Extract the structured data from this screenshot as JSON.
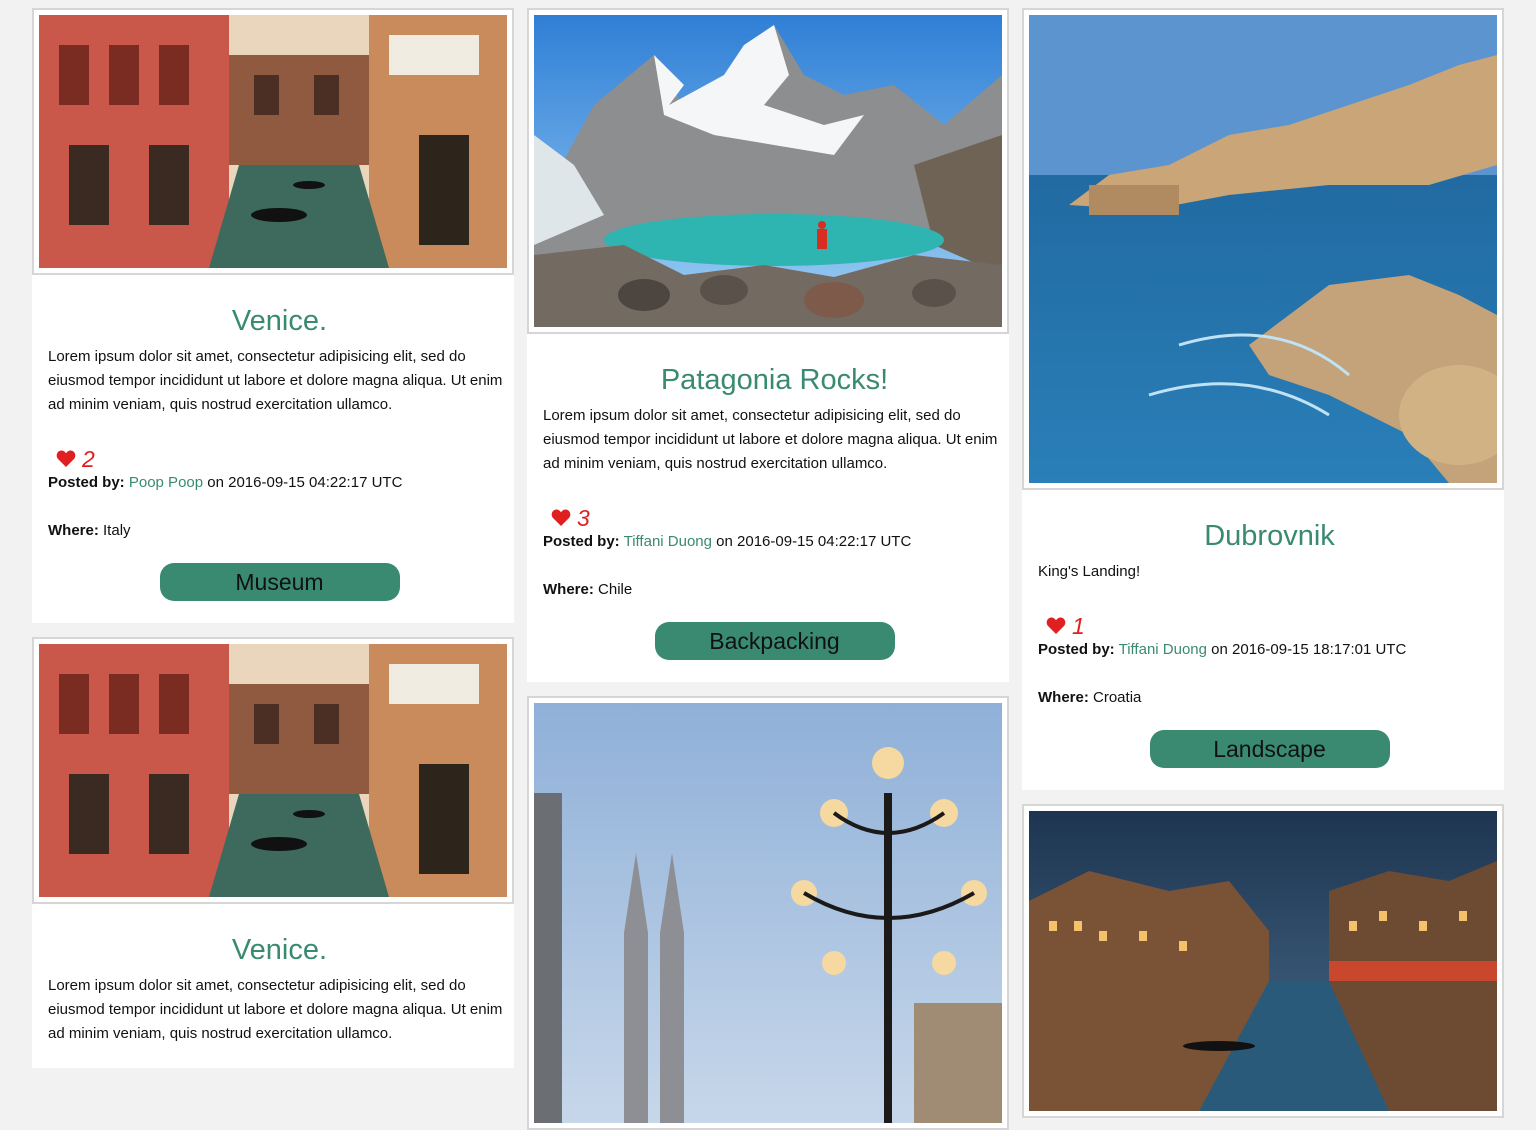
{
  "labels": {
    "posted_by": "Posted by:",
    "on": "on",
    "where": "Where:"
  },
  "columns": [
    [
      {
        "image": "venice-canal-photo",
        "title": "Venice.",
        "description": "Lorem ipsum dolor sit amet, consectetur adipisicing elit, sed do eiusmod tempor incididunt ut labore et dolore magna aliqua. Ut enim ad minim veniam, quis nostrud exercitation ullamco.",
        "likes": "2",
        "author": "Poop Poop",
        "timestamp": "2016-09-15 04:22:17 UTC",
        "where": "Italy",
        "tag": "Museum"
      },
      {
        "image": "venice-canal-photo",
        "title": "Venice.",
        "description": "Lorem ipsum dolor sit amet, consectetur adipisicing elit, sed do eiusmod tempor incididunt ut labore et dolore magna aliqua. Ut enim ad minim veniam, quis nostrud exercitation ullamco.",
        "likes": "",
        "author": "",
        "timestamp": "",
        "where": "",
        "tag": ""
      }
    ],
    [
      {
        "image": "patagonia-mountain-lake-photo",
        "title": "Patagonia Rocks!",
        "description": "Lorem ipsum dolor sit amet, consectetur adipisicing elit, sed do eiusmod tempor incididunt ut labore et dolore magna aliqua. Ut enim ad minim veniam, quis nostrud exercitation ullamco.",
        "likes": "3",
        "author": "Tiffani Duong",
        "timestamp": "2016-09-15 04:22:17 UTC",
        "where": "Chile",
        "tag": "Backpacking"
      },
      {
        "image": "cathedral-street-lamps-photo",
        "title": "",
        "description": "",
        "likes": "",
        "author": "",
        "timestamp": "",
        "where": "",
        "tag": ""
      }
    ],
    [
      {
        "image": "dubrovnik-coast-photo",
        "title": "Dubrovnik",
        "description": "King's Landing!",
        "likes": "1",
        "author": "Tiffani Duong",
        "timestamp": "2016-09-15 18:17:01 UTC",
        "where": "Croatia",
        "tag": "Landscape"
      },
      {
        "image": "venice-grand-canal-night-photo",
        "title": "",
        "description": "",
        "likes": "",
        "author": "",
        "timestamp": "",
        "where": "",
        "tag": ""
      }
    ]
  ],
  "colors": {
    "accent": "#3a8a72",
    "like": "#e02020",
    "background": "#f2f2f2"
  }
}
